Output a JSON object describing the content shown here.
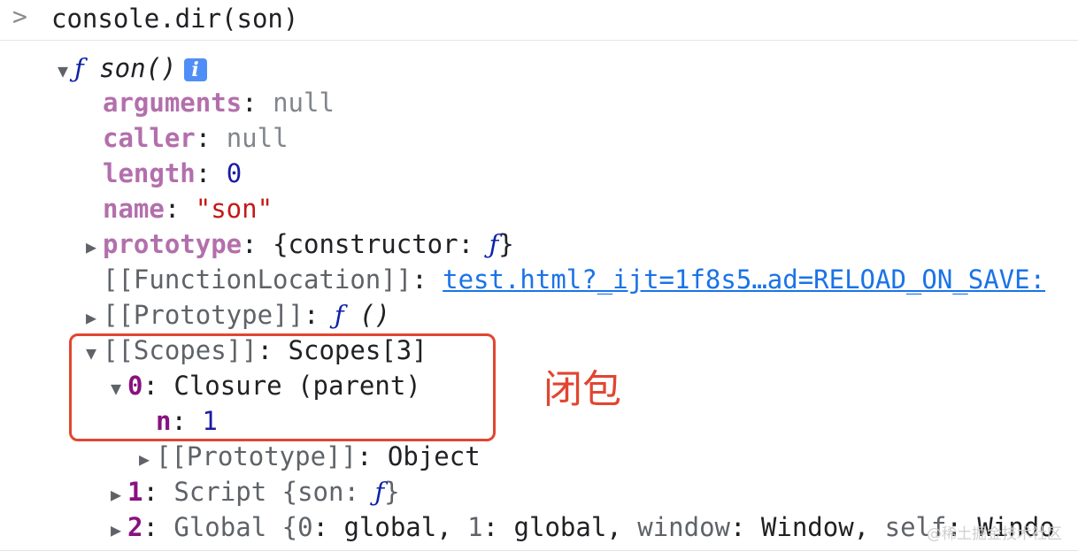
{
  "console": {
    "prompt": ">",
    "command": "console.dir(son)"
  },
  "tree": {
    "root_fn": "ƒ",
    "root_name": "son()",
    "info_icon": "i",
    "arguments": {
      "key": "arguments",
      "sep": ": ",
      "value": "null"
    },
    "caller": {
      "key": "caller",
      "sep": ": ",
      "value": "null"
    },
    "length": {
      "key": "length",
      "sep": ": ",
      "value": "0"
    },
    "name": {
      "key": "name",
      "sep": ": ",
      "value": "\"son\""
    },
    "prototype": {
      "key": "prototype",
      "sep": ": ",
      "open": "{constructor: ",
      "fn": "ƒ",
      "close": "}"
    },
    "function_location": {
      "key": "[[FunctionLocation]]",
      "sep": ": ",
      "value": "test.html?_ijt=1f8s5…ad=RELOAD_ON_SAVE:"
    },
    "proto_internal": {
      "key": "[[Prototype]]",
      "sep": ": ",
      "fn": "ƒ",
      "value": " ()"
    },
    "scopes": {
      "key": "[[Scopes]]",
      "sep": ": ",
      "value": "Scopes[3]"
    },
    "scope0": {
      "key": "0",
      "sep": ": ",
      "value": "Closure (parent)"
    },
    "scope0_n": {
      "key": "n",
      "sep": ": ",
      "value": "1"
    },
    "scope0_proto": {
      "key": "[[Prototype]]",
      "sep": ": ",
      "value": "Object"
    },
    "scope1": {
      "key": "1",
      "sep": ": ",
      "value_a": "Script {son: ",
      "fn": "ƒ",
      "value_b": "}"
    },
    "scope2": {
      "key": "2",
      "sep": ": ",
      "label": "Global {",
      "k0": "0",
      "v0": ": global, ",
      "k1": "1",
      "v1": ": global, ",
      "k2": "window",
      "v2": ": Window, ",
      "k3": "self",
      "v3": ": Windo"
    }
  },
  "annotation": "闭包",
  "watermark": "@稀土掘金技术社区",
  "colors": {
    "highlight_box": "#e24530",
    "key": "#881280",
    "link": "#1a73e8",
    "string": "#c41a16",
    "number": "#1a1aa6"
  },
  "icons": {
    "expanded": "triangle-down-icon",
    "collapsed": "triangle-right-icon",
    "prompt": "chevron-right-icon",
    "info": "info-icon"
  }
}
